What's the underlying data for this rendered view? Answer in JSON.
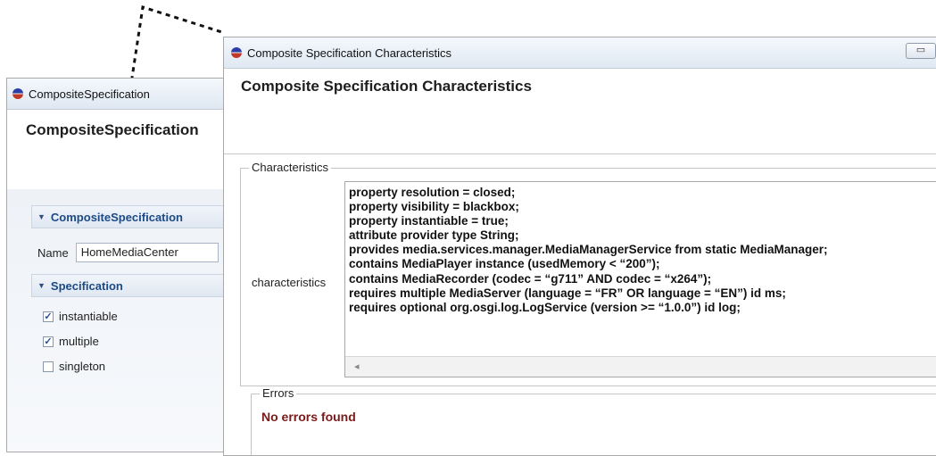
{
  "left_window": {
    "title": "CompositeSpecification",
    "header": "CompositeSpecification",
    "sections": [
      {
        "label": "CompositeSpecification"
      },
      {
        "label": "Specification"
      }
    ],
    "name_label": "Name",
    "name_value": "HomeMediaCenter",
    "checkboxes": [
      {
        "label": "instantiable",
        "checked": true
      },
      {
        "label": "multiple",
        "checked": true
      },
      {
        "label": "singleton",
        "checked": false
      }
    ]
  },
  "right_window": {
    "title": "Composite Specification Characteristics",
    "header": "Composite Specification Characteristics",
    "characteristics_group": "Characteristics",
    "characteristics_label": "characteristics",
    "characteristics_lines": [
      "property resolution = closed;",
      "property visibility = blackbox;",
      "property instantiable = true;",
      "attribute provider type String;",
      "provides media.services.manager.MediaManagerService from static MediaManager;",
      "contains MediaPlayer instance (usedMemory < “200”);",
      "contains MediaRecorder (codec = “g711” AND codec = “x264”);",
      "requires multiple MediaServer (language = “FR” OR language = “EN”) id ms;",
      "requires optional org.osgi.log.LogService (version >= “1.0.0”) id log;"
    ],
    "errors_group": "Errors",
    "errors_message": "No errors found"
  },
  "icons": {
    "app": "eclipse-icon",
    "expand": "triangle-down-icon",
    "check": "checkmark-icon",
    "scroll_left": "chevron-left-icon",
    "minimize": "minimize-icon"
  },
  "colors": {
    "section_text": "#1c4a85",
    "error_text": "#7a1a1a",
    "titlebar": "#dfe8f2"
  }
}
